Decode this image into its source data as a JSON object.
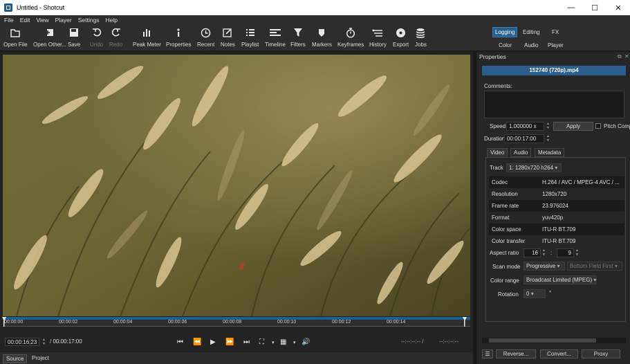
{
  "window": {
    "title": "Untitled - Shotcut",
    "minimize": "—",
    "maximize": "☐",
    "close": "✕"
  },
  "menu": [
    "File",
    "Edit",
    "View",
    "Player",
    "Settings",
    "Help"
  ],
  "toolbar": [
    {
      "label": "Open File",
      "icon": "open-file-icon"
    },
    {
      "label": "Open Other...",
      "icon": "open-other-icon"
    },
    {
      "label": "Save",
      "icon": "save-icon"
    },
    {
      "label": "Undo",
      "icon": "undo-icon"
    },
    {
      "label": "Redo",
      "icon": "redo-icon"
    },
    {
      "label": "Peak Meter",
      "icon": "peak-meter-icon"
    },
    {
      "label": "Properties",
      "icon": "properties-icon"
    },
    {
      "label": "Recent",
      "icon": "recent-icon"
    },
    {
      "label": "Notes",
      "icon": "notes-icon"
    },
    {
      "label": "Playlist",
      "icon": "playlist-icon"
    },
    {
      "label": "Timeline",
      "icon": "timeline-icon"
    },
    {
      "label": "Filters",
      "icon": "filters-icon"
    },
    {
      "label": "Markers",
      "icon": "markers-icon"
    },
    {
      "label": "Keyframes",
      "icon": "keyframes-icon"
    },
    {
      "label": "History",
      "icon": "history-icon"
    },
    {
      "label": "Export",
      "icon": "export-icon"
    },
    {
      "label": "Jobs",
      "icon": "jobs-icon"
    }
  ],
  "layouts": {
    "logging": "Logging",
    "editing": "Editing",
    "fx": "FX",
    "color": "Color",
    "audio": "Audio",
    "player": "Player"
  },
  "timeline_ticks": [
    "00:00:00",
    "00:00:02",
    "00:00:04",
    "00:00:06",
    "00:00:08",
    "00:00:10",
    "00:00:12",
    "00:00:14"
  ],
  "transport": {
    "position": "00:00:16:23",
    "duration": "/ 00:00:17:00",
    "in_point": "--:--:--:-- /",
    "out_point": "--:--:--:--"
  },
  "source_tabs": {
    "source": "Source",
    "project": "Project"
  },
  "properties": {
    "heading": "Properties",
    "filename": "152740 (720p).mp4",
    "comments_label": "Comments:",
    "speed_label": "Speed",
    "speed_value": "1.000000 x",
    "apply": "Apply",
    "pitch_label": "Pitch Comp",
    "duration_label": "Duration",
    "duration_value": "00:00:17:00",
    "tabs": {
      "video": "Video",
      "audio": "Audio",
      "metadata": "Metadata"
    },
    "track_label": "Track",
    "track_value": "1: 1280x720 h264",
    "info": [
      {
        "k": "Codec",
        "v": "H.264 / AVC / MPEG-4 AVC / ..."
      },
      {
        "k": "Resolution",
        "v": "1280x720"
      },
      {
        "k": "Frame rate",
        "v": "23.976024"
      },
      {
        "k": "Format",
        "v": "yuv420p"
      },
      {
        "k": "Color space",
        "v": "ITU-R BT.709"
      },
      {
        "k": "Color transfer",
        "v": "ITU-R BT.709"
      }
    ],
    "aspect_label": "Aspect ratio",
    "aspect_w": "16",
    "aspect_sep": ":",
    "aspect_h": "9",
    "scan_label": "Scan mode",
    "scan_value": "Progressive",
    "field_value": "Bottom Field First",
    "range_label": "Color range",
    "range_value": "Broadcast Limited (MPEG)",
    "rotation_label": "Rotation",
    "rotation_value": "0",
    "rotation_unit": "°",
    "reverse": "Reverse...",
    "convert": "Convert...",
    "proxy": "Proxy"
  }
}
